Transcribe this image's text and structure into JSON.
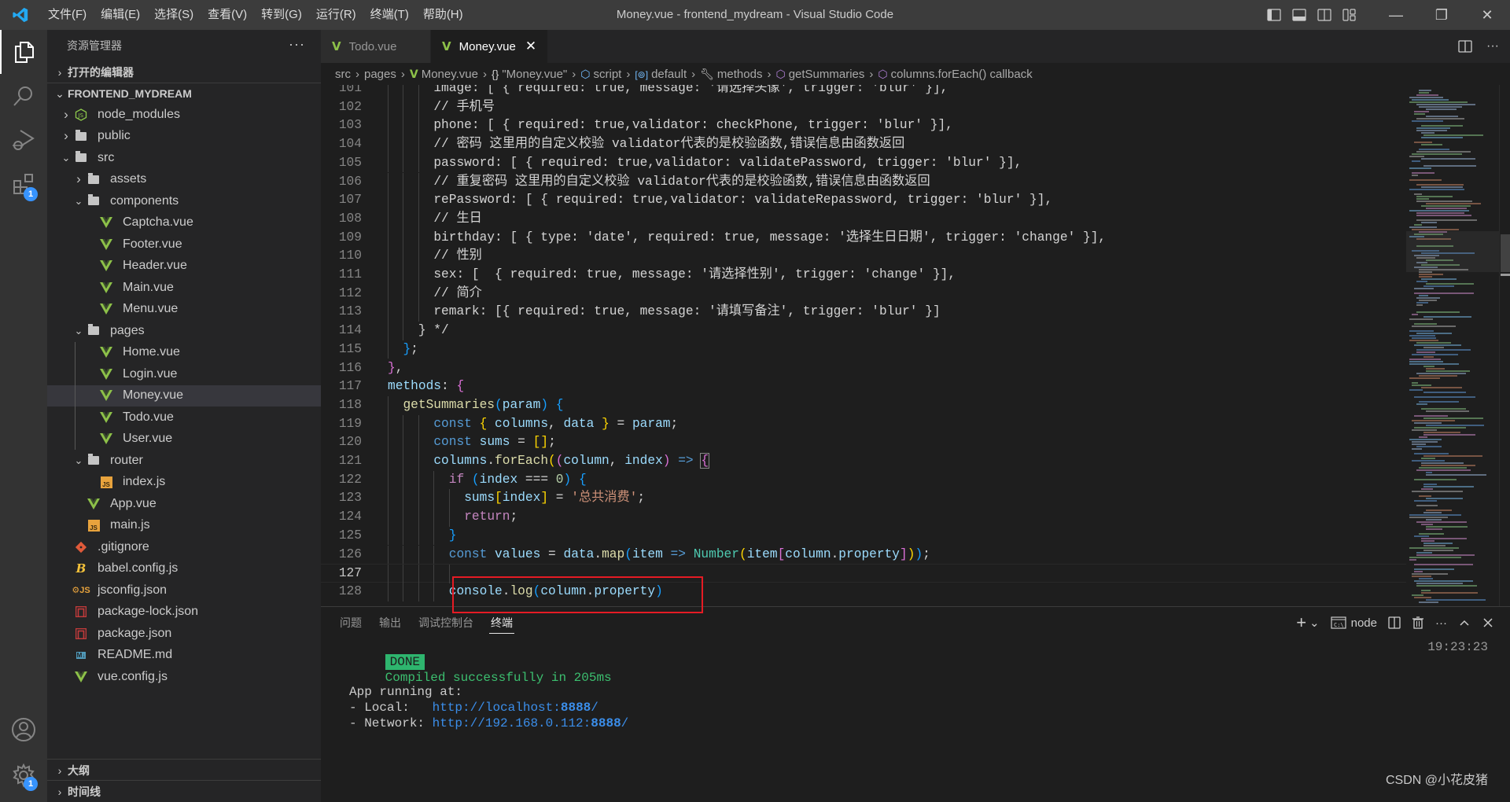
{
  "window": {
    "title": "Money.vue - frontend_mydream - Visual Studio Code",
    "menu": [
      "文件(F)",
      "编辑(E)",
      "选择(S)",
      "查看(V)",
      "转到(G)",
      "运行(R)",
      "终端(T)",
      "帮助(H)"
    ],
    "controls": {
      "minimize": "—",
      "restore": "❐",
      "close": "✕"
    }
  },
  "activity_bar": {
    "items": [
      {
        "name": "explorer",
        "icon": "files-icon",
        "active": true
      },
      {
        "name": "search",
        "icon": "search-icon"
      },
      {
        "name": "run-debug",
        "icon": "debug-icon"
      },
      {
        "name": "extensions",
        "icon": "extensions-icon",
        "badge": "1"
      }
    ],
    "bottom": [
      {
        "name": "accounts",
        "icon": "account-icon"
      },
      {
        "name": "manage",
        "icon": "gear-icon",
        "badge": "1"
      }
    ]
  },
  "sidebar": {
    "title": "资源管理器",
    "more": "···",
    "open_editors_label": "打开的编辑器",
    "project_label": "FRONTEND_MYDREAM",
    "tree": [
      {
        "label": "node_modules",
        "depth": 1,
        "type": "folder-node",
        "expanded": false
      },
      {
        "label": "public",
        "depth": 1,
        "type": "folder",
        "expanded": false
      },
      {
        "label": "src",
        "depth": 1,
        "type": "folder",
        "expanded": true
      },
      {
        "label": "assets",
        "depth": 2,
        "type": "folder",
        "expanded": false
      },
      {
        "label": "components",
        "depth": 2,
        "type": "folder",
        "expanded": true
      },
      {
        "label": "Captcha.vue",
        "depth": 3,
        "type": "vue"
      },
      {
        "label": "Footer.vue",
        "depth": 3,
        "type": "vue"
      },
      {
        "label": "Header.vue",
        "depth": 3,
        "type": "vue"
      },
      {
        "label": "Main.vue",
        "depth": 3,
        "type": "vue"
      },
      {
        "label": "Menu.vue",
        "depth": 3,
        "type": "vue"
      },
      {
        "label": "pages",
        "depth": 2,
        "type": "folder",
        "expanded": true
      },
      {
        "label": "Home.vue",
        "depth": 3,
        "type": "vue"
      },
      {
        "label": "Login.vue",
        "depth": 3,
        "type": "vue"
      },
      {
        "label": "Money.vue",
        "depth": 3,
        "type": "vue",
        "selected": true
      },
      {
        "label": "Todo.vue",
        "depth": 3,
        "type": "vue"
      },
      {
        "label": "User.vue",
        "depth": 3,
        "type": "vue"
      },
      {
        "label": "router",
        "depth": 2,
        "type": "folder",
        "expanded": true
      },
      {
        "label": "index.js",
        "depth": 3,
        "type": "js"
      },
      {
        "label": "App.vue",
        "depth": 2,
        "type": "vue"
      },
      {
        "label": "main.js",
        "depth": 2,
        "type": "js"
      },
      {
        "label": ".gitignore",
        "depth": 1,
        "type": "git"
      },
      {
        "label": "babel.config.js",
        "depth": 1,
        "type": "babel"
      },
      {
        "label": "jsconfig.json",
        "depth": 1,
        "type": "jsconfig"
      },
      {
        "label": "package-lock.json",
        "depth": 1,
        "type": "npm"
      },
      {
        "label": "package.json",
        "depth": 1,
        "type": "npm"
      },
      {
        "label": "README.md",
        "depth": 1,
        "type": "md"
      },
      {
        "label": "vue.config.js",
        "depth": 1,
        "type": "vue"
      }
    ],
    "outline_label": "大纲",
    "timeline_label": "时间线"
  },
  "tabs": [
    {
      "label": "Todo.vue",
      "active": false
    },
    {
      "label": "Money.vue",
      "active": true,
      "close": "✕"
    }
  ],
  "breadcrumbs": [
    {
      "label": "src",
      "icon": ""
    },
    {
      "label": "pages",
      "icon": ""
    },
    {
      "label": "Money.vue",
      "icon": "vue-icon"
    },
    {
      "label": "\"Money.vue\"",
      "icon": "braces-icon"
    },
    {
      "label": "script",
      "icon": "module-icon"
    },
    {
      "label": "default",
      "icon": "variable-icon"
    },
    {
      "label": "methods",
      "icon": "wrench-icon"
    },
    {
      "label": "getSummaries",
      "icon": "method-icon"
    },
    {
      "label": "columns.forEach() callback",
      "icon": "method-icon"
    }
  ],
  "code": {
    "current_line": 127,
    "lines": [
      {
        "n": "101",
        "indent": 6,
        "tokens": [
          [
            "c-cm",
            "image: [ { required: true, message: '请选择头像', trigger: 'blur' }],"
          ]
        ]
      },
      {
        "n": "102",
        "indent": 6,
        "tokens": [
          [
            "c-cm",
            "// 手机号"
          ]
        ]
      },
      {
        "n": "103",
        "indent": 6,
        "tokens": [
          [
            "c-cm",
            "phone: [ { required: true,validator: checkPhone, trigger: 'blur' }],"
          ]
        ]
      },
      {
        "n": "104",
        "indent": 6,
        "tokens": [
          [
            "c-cm",
            "// 密码 这里用的自定义校验 validator代表的是校验函数,错误信息由函数返回"
          ]
        ]
      },
      {
        "n": "105",
        "indent": 6,
        "tokens": [
          [
            "c-cm",
            "password: [ { required: true,validator: validatePassword, trigger: 'blur' }],"
          ]
        ]
      },
      {
        "n": "106",
        "indent": 6,
        "tokens": [
          [
            "c-cm",
            "// 重复密码 这里用的自定义校验 validator代表的是校验函数,错误信息由函数返回"
          ]
        ]
      },
      {
        "n": "107",
        "indent": 6,
        "tokens": [
          [
            "c-cm",
            "rePassword: [ { required: true,validator: validateRepassword, trigger: 'blur' }],"
          ]
        ]
      },
      {
        "n": "108",
        "indent": 6,
        "tokens": [
          [
            "c-cm",
            "// 生日"
          ]
        ]
      },
      {
        "n": "109",
        "indent": 6,
        "tokens": [
          [
            "c-cm",
            "birthday: [ { type: 'date', required: true, message: '选择生日日期', trigger: 'change' }],"
          ]
        ]
      },
      {
        "n": "110",
        "indent": 6,
        "tokens": [
          [
            "c-cm",
            "// 性别"
          ]
        ]
      },
      {
        "n": "111",
        "indent": 6,
        "tokens": [
          [
            "c-cm",
            "sex: [  { required: true, message: '请选择性别', trigger: 'change' }],"
          ]
        ]
      },
      {
        "n": "112",
        "indent": 6,
        "tokens": [
          [
            "c-cm",
            "// 简介"
          ]
        ]
      },
      {
        "n": "113",
        "indent": 6,
        "tokens": [
          [
            "c-cm",
            "remark: [{ required: true, message: '请填写备注', trigger: 'blur' }]"
          ]
        ]
      },
      {
        "n": "114",
        "indent": 4,
        "tokens": [
          [
            "c-cm",
            "} */"
          ]
        ]
      },
      {
        "n": "115",
        "indent": 2,
        "tokens": [
          [
            "c-b3",
            "}"
          ],
          [
            "",
            ";"
          ]
        ]
      },
      {
        "n": "116",
        "indent": 0,
        "tokens": [
          [
            "c-b2",
            "}"
          ],
          [
            "",
            ","
          ]
        ]
      },
      {
        "n": "117",
        "indent": 0,
        "tokens": [
          [
            "c-var",
            "methods"
          ],
          [
            "",
            ": "
          ],
          [
            "c-b2",
            "{"
          ]
        ]
      },
      {
        "n": "118",
        "indent": 2,
        "tokens": [
          [
            "c-fn",
            "getSummaries"
          ],
          [
            "c-b3",
            "("
          ],
          [
            "c-var",
            "param"
          ],
          [
            "c-b3",
            ")"
          ],
          [
            "",
            " "
          ],
          [
            "c-b3",
            "{"
          ]
        ]
      },
      {
        "n": "119",
        "indent": 6,
        "tokens": [
          [
            "c-kw",
            "const"
          ],
          [
            "",
            " "
          ],
          [
            "c-b1",
            "{"
          ],
          [
            "",
            " "
          ],
          [
            "c-var",
            "columns"
          ],
          [
            "",
            ", "
          ],
          [
            "c-var",
            "data"
          ],
          [
            "",
            " "
          ],
          [
            "c-b1",
            "}"
          ],
          [
            "",
            " = "
          ],
          [
            "c-var",
            "param"
          ],
          [
            "",
            ";"
          ]
        ]
      },
      {
        "n": "120",
        "indent": 6,
        "tokens": [
          [
            "c-kw",
            "const"
          ],
          [
            "",
            " "
          ],
          [
            "c-var",
            "sums"
          ],
          [
            "",
            " = "
          ],
          [
            "c-b1",
            "[]"
          ],
          [
            "",
            ";"
          ]
        ]
      },
      {
        "n": "121",
        "indent": 6,
        "tokens": [
          [
            "c-var",
            "columns"
          ],
          [
            "",
            "."
          ],
          [
            "c-fn",
            "forEach"
          ],
          [
            "c-b1",
            "("
          ],
          [
            "c-b2",
            "("
          ],
          [
            "c-var",
            "column"
          ],
          [
            "",
            ", "
          ],
          [
            "c-var",
            "index"
          ],
          [
            "c-b2",
            ")"
          ],
          [
            "",
            " "
          ],
          [
            "c-kw",
            "=>"
          ],
          [
            "",
            " "
          ],
          [
            "c-b2 bm",
            "{"
          ]
        ]
      },
      {
        "n": "122",
        "indent": 8,
        "tokens": [
          [
            "c-ctl",
            "if"
          ],
          [
            "",
            " "
          ],
          [
            "c-b3",
            "("
          ],
          [
            "c-var",
            "index"
          ],
          [
            "",
            " === "
          ],
          [
            "c-num",
            "0"
          ],
          [
            "c-b3",
            ")"
          ],
          [
            "",
            " "
          ],
          [
            "c-b3",
            "{"
          ]
        ]
      },
      {
        "n": "123",
        "indent": 10,
        "tokens": [
          [
            "c-var",
            "sums"
          ],
          [
            "c-b1",
            "["
          ],
          [
            "c-var",
            "index"
          ],
          [
            "c-b1",
            "]"
          ],
          [
            "",
            " = "
          ],
          [
            "c-str",
            "'总共消费'"
          ],
          [
            "",
            ";"
          ]
        ]
      },
      {
        "n": "124",
        "indent": 10,
        "tokens": [
          [
            "c-ctl",
            "return"
          ],
          [
            "",
            ";"
          ]
        ]
      },
      {
        "n": "125",
        "indent": 8,
        "tokens": [
          [
            "c-b3",
            "}"
          ]
        ]
      },
      {
        "n": "126",
        "indent": 8,
        "tokens": [
          [
            "c-kw",
            "const"
          ],
          [
            "",
            " "
          ],
          [
            "c-var",
            "values"
          ],
          [
            "",
            " = "
          ],
          [
            "c-var",
            "data"
          ],
          [
            "",
            "."
          ],
          [
            "c-fn",
            "map"
          ],
          [
            "c-b3",
            "("
          ],
          [
            "c-var",
            "item"
          ],
          [
            "",
            " "
          ],
          [
            "c-kw",
            "=>"
          ],
          [
            "",
            " "
          ],
          [
            "c-cls",
            "Number"
          ],
          [
            "c-b1",
            "("
          ],
          [
            "c-var",
            "item"
          ],
          [
            "c-b2",
            "["
          ],
          [
            "c-var",
            "column"
          ],
          [
            "",
            "."
          ],
          [
            "c-var",
            "property"
          ],
          [
            "c-b2",
            "]"
          ],
          [
            "c-b1",
            ")"
          ],
          [
            "c-b3",
            ")"
          ],
          [
            "",
            ";"
          ]
        ]
      },
      {
        "n": "127",
        "indent": 8,
        "tokens": []
      },
      {
        "n": "128",
        "indent": 8,
        "tokens": [
          [
            "c-var",
            "console"
          ],
          [
            "",
            "."
          ],
          [
            "c-fn",
            "log"
          ],
          [
            "c-b3",
            "("
          ],
          [
            "c-var",
            "column"
          ],
          [
            "",
            "."
          ],
          [
            "c-var",
            "property"
          ],
          [
            "c-b3",
            ")"
          ]
        ]
      }
    ]
  },
  "panel": {
    "tabs": [
      {
        "label": "问题",
        "active": false
      },
      {
        "label": "输出",
        "active": false
      },
      {
        "label": "调试控制台",
        "active": false
      },
      {
        "label": "终端",
        "active": true
      }
    ],
    "terminal_name": "node",
    "actions": {
      "add": "+",
      "dropdown": "⌄",
      "split": "split-icon",
      "kill": "trash-icon",
      "more": "···",
      "maximize": "^",
      "close": "✕"
    },
    "time": "19:23:23",
    "output": {
      "done_badge": "DONE",
      "compiled": "Compiled successfully in 205ms",
      "app_running": "App running at:",
      "local_label": "- Local:   ",
      "local_url_prefix": "http://localhost:",
      "local_port": "8888",
      "local_suffix": "/",
      "network_label": "- Network: ",
      "network_url_prefix": "http://192.168.0.112:",
      "network_port": "8888",
      "network_suffix": "/"
    }
  },
  "annotation": {
    "highlight_color": "#e51b24"
  },
  "watermark": "CSDN @小花皮猪"
}
